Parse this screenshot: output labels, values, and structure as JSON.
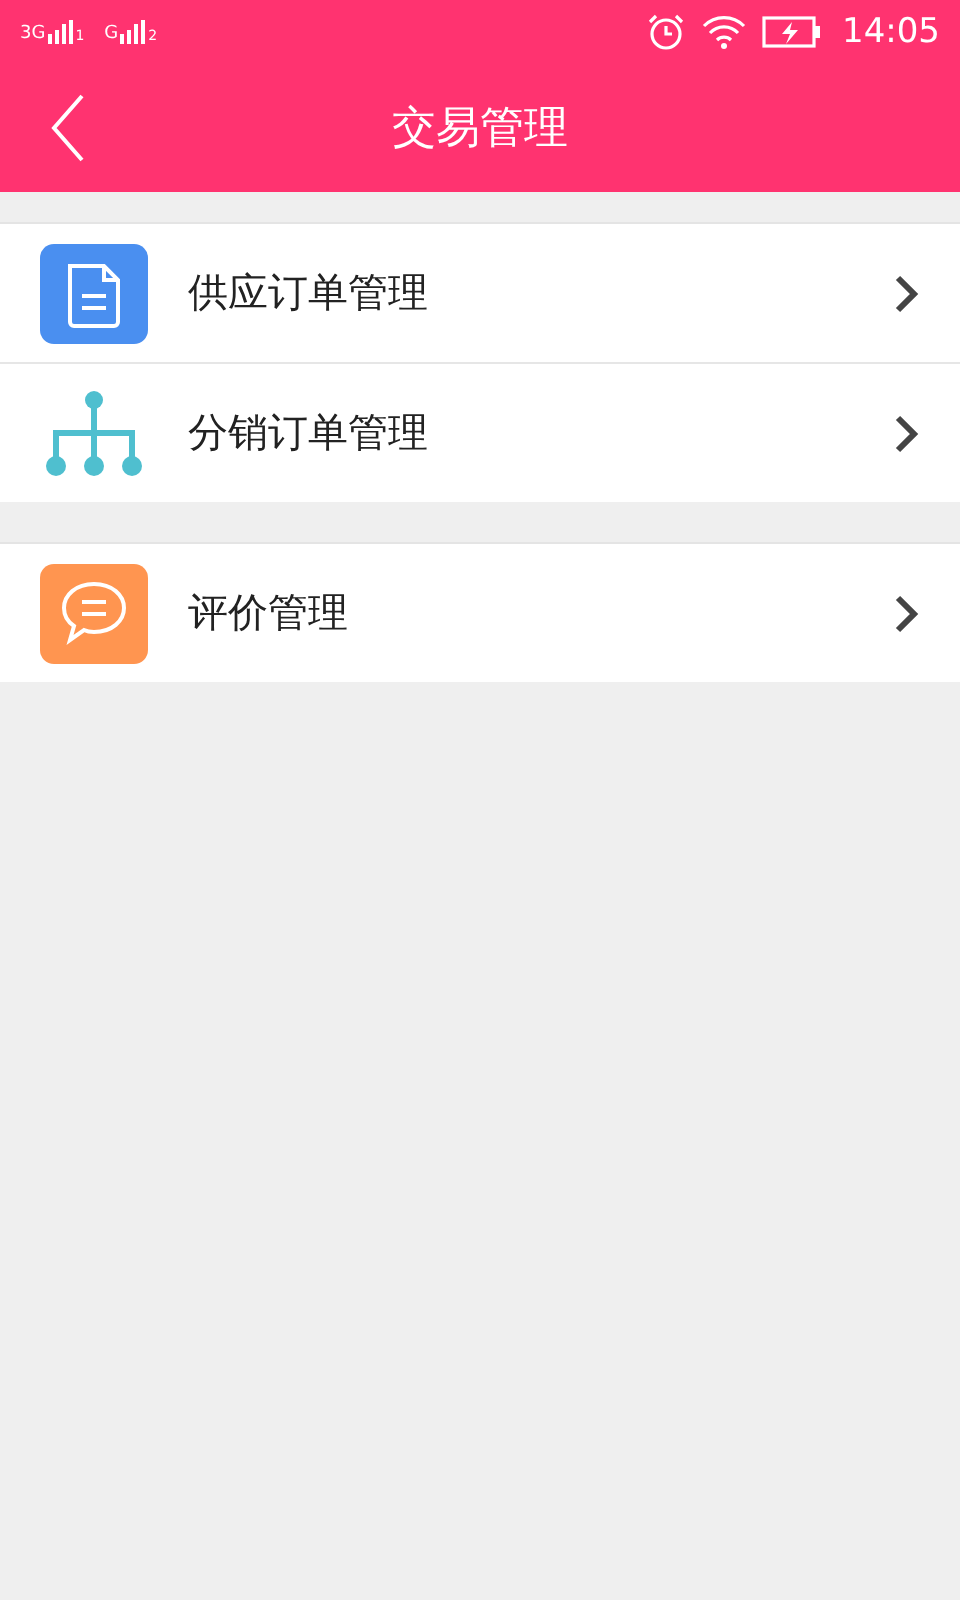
{
  "status_bar": {
    "sim1": {
      "network": "3G",
      "slot": "1"
    },
    "sim2": {
      "network": "G",
      "slot": "2"
    },
    "time": "14:05"
  },
  "header": {
    "title": "交易管理"
  },
  "groups": [
    {
      "items": [
        {
          "kind": "document",
          "label": "供应订单管理"
        },
        {
          "kind": "hierarchy",
          "label": "分销订单管理"
        }
      ]
    },
    {
      "items": [
        {
          "kind": "chat",
          "label": "评价管理"
        }
      ]
    }
  ]
}
